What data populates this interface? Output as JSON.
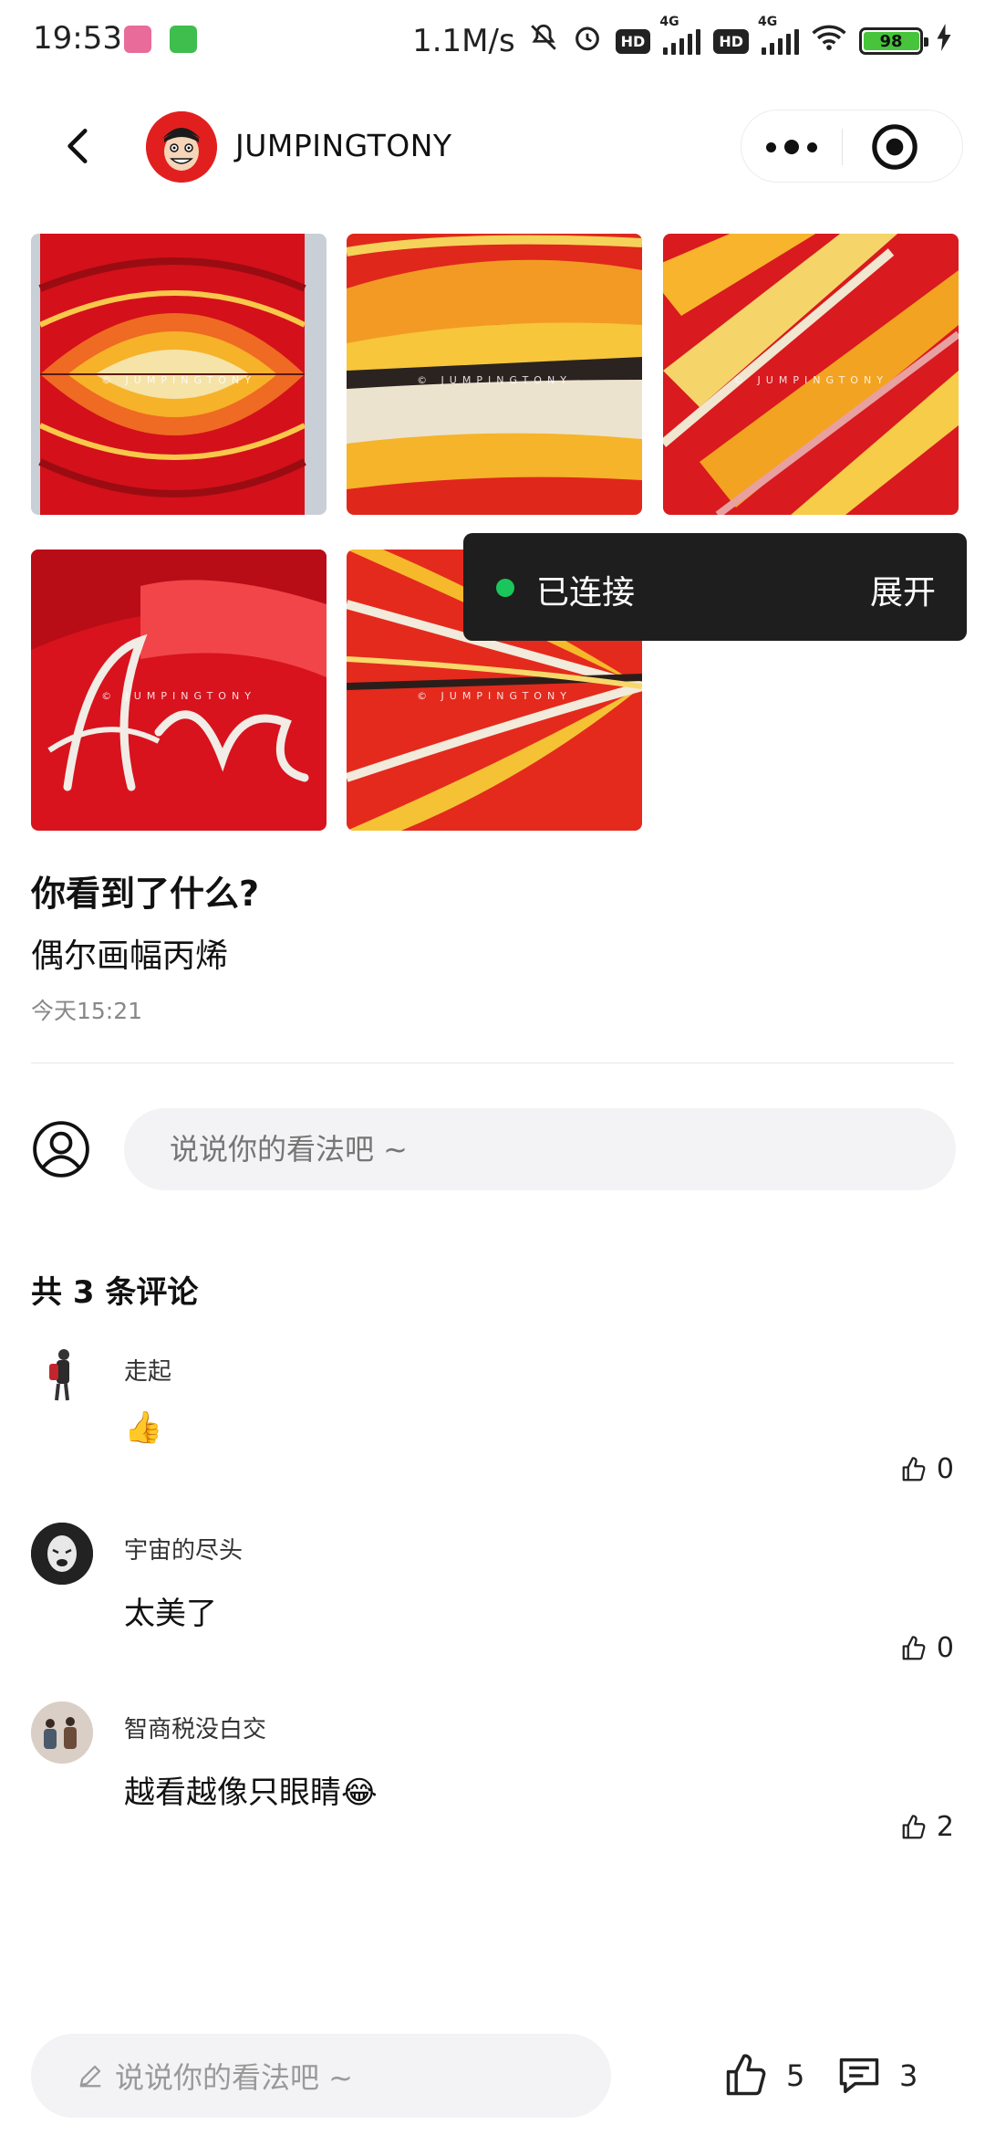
{
  "status_bar": {
    "time": "19:53",
    "network_speed": "1.1M/s",
    "hd_label": "HD",
    "network_type": "4G",
    "battery": "98",
    "battery_level": 0.98
  },
  "header": {
    "username": "JUMPINGTONY",
    "avatar_color": "#e21f1f"
  },
  "gallery": {
    "watermark": "© JUMPINGTONY",
    "image_count": 5
  },
  "toast": {
    "status_text": "已连接",
    "action_label": "展开",
    "dot_color": "#1ac65b"
  },
  "post": {
    "title": "你看到了什么?",
    "body": "偶尔画幅丙烯",
    "time": "今天15:21"
  },
  "comment_input": {
    "placeholder": "说说你的看法吧 ~"
  },
  "comments_header": "共 3 条评论",
  "comments": [
    {
      "name": "走起",
      "text": "👍",
      "likes": "0"
    },
    {
      "name": "宇宙的尽头",
      "text": "太美了",
      "likes": "0"
    },
    {
      "name": "智商税没白交",
      "text": "越看越像只眼睛😂",
      "likes": "2"
    }
  ],
  "bottom_bar": {
    "placeholder": "说说你的看法吧 ~",
    "like_count": "5",
    "comment_count": "3"
  },
  "icons": [
    "back-arrow-icon",
    "more-dots-icon",
    "target-icon",
    "user-outline-icon",
    "thumbs-up-icon",
    "comment-bubble-icon",
    "pencil-icon"
  ]
}
